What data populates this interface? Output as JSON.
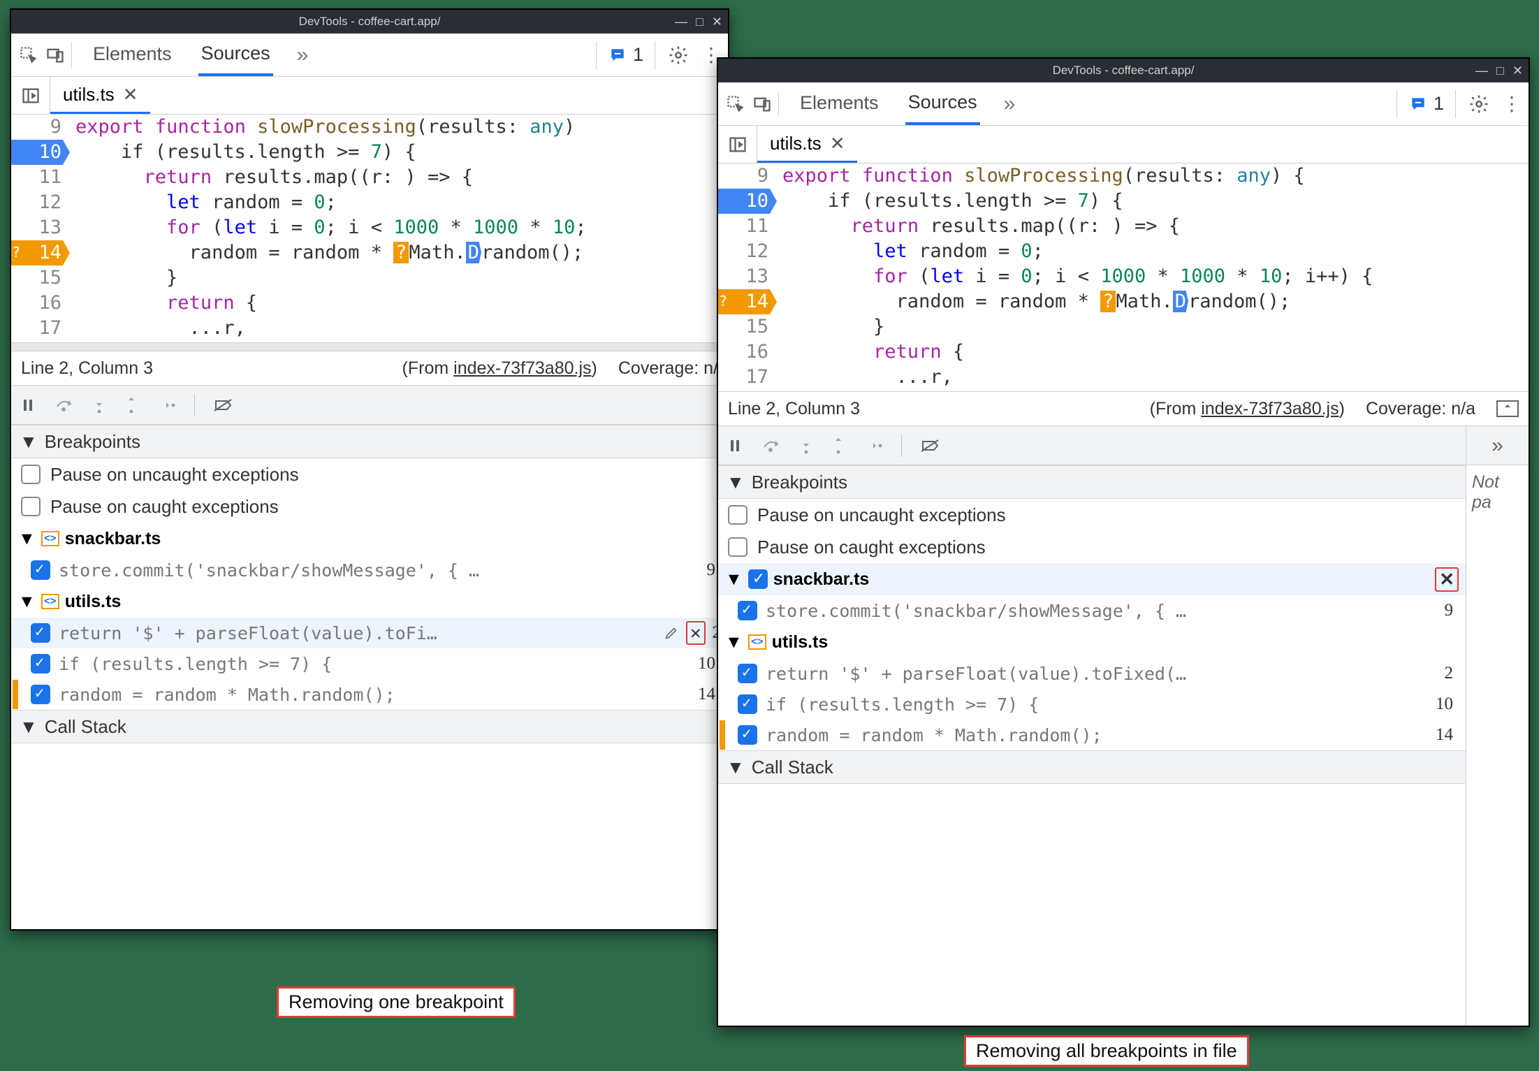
{
  "windowTitle": "DevTools - coffee-cart.app/",
  "tabs": {
    "elements": "Elements",
    "sources": "Sources"
  },
  "issuesCount": "1",
  "fileTab": "utils.ts",
  "code": {
    "lines": [
      "9",
      "10",
      "11",
      "12",
      "13",
      "14",
      "15",
      "16",
      "17"
    ],
    "l9_export": "export",
    "l9_function": "function",
    "l9_name": "slowProcessing",
    "l9_tail_a": "(results: ",
    "l9_any": "any",
    "l9_tail_b": ")",
    "l9_tail_long": ") {",
    "l10": "    if (results.length >= ",
    "l10_num": "7",
    "l10_tail": ") {",
    "l11_ret": "return",
    "l11_tail": " results.map((r: ",
    "l11_tail2": ") => {",
    "l12_let": "let",
    "l12_tail": " random = ",
    "l12_zero": "0",
    "l13_for": "for",
    "l13_a": " (",
    "l13_let": "let",
    "l13_b": " i = ",
    "l13_c": "; i < ",
    "l13_n1": "1000",
    "l13_n2": "1000",
    "l13_n3": "10",
    "l13_tail_short": ";",
    "l13_tail_long": "; i++) {",
    "l14": "          random = random * ",
    "l14_q": "?",
    "l14_math": "Math.",
    "l14_d": "D",
    "l14_rand": "random();",
    "l15": "        }",
    "l16_ret": "return",
    "l16_tail": " {",
    "l17": "          ...r,"
  },
  "statusbar": {
    "pos": "Line 2, Column 3",
    "fromLabel": "(From ",
    "fromFile": "index-73f73a80.js",
    "fromClose": ")",
    "coverage_short": "Coverage: n/",
    "coverage_long": "Coverage: n/a"
  },
  "sections": {
    "breakpoints": "Breakpoints",
    "callstack": "Call Stack",
    "pauseUncaught": "Pause on uncaught exceptions",
    "pauseCaught": "Pause on caught exceptions",
    "notPa": "Not pa"
  },
  "files": {
    "snackbar": "snackbar.ts",
    "utils": "utils.ts"
  },
  "bp": {
    "snackbarLine": "store.commit('snackbar/showMessage', { …",
    "snackbarLn": "9",
    "utilsA": "return '$' + parseFloat(value).toFi…",
    "utilsA_long": "return '$' + parseFloat(value).toFixed(…",
    "utilsA_ln": "2",
    "utilsB": "if (results.length >= 7) {",
    "utilsB_ln": "10",
    "utilsC": "random = random * Math.random();",
    "utilsC_ln": "14"
  },
  "captions": {
    "left": "Removing one breakpoint",
    "right": "Removing all breakpoints in file"
  }
}
